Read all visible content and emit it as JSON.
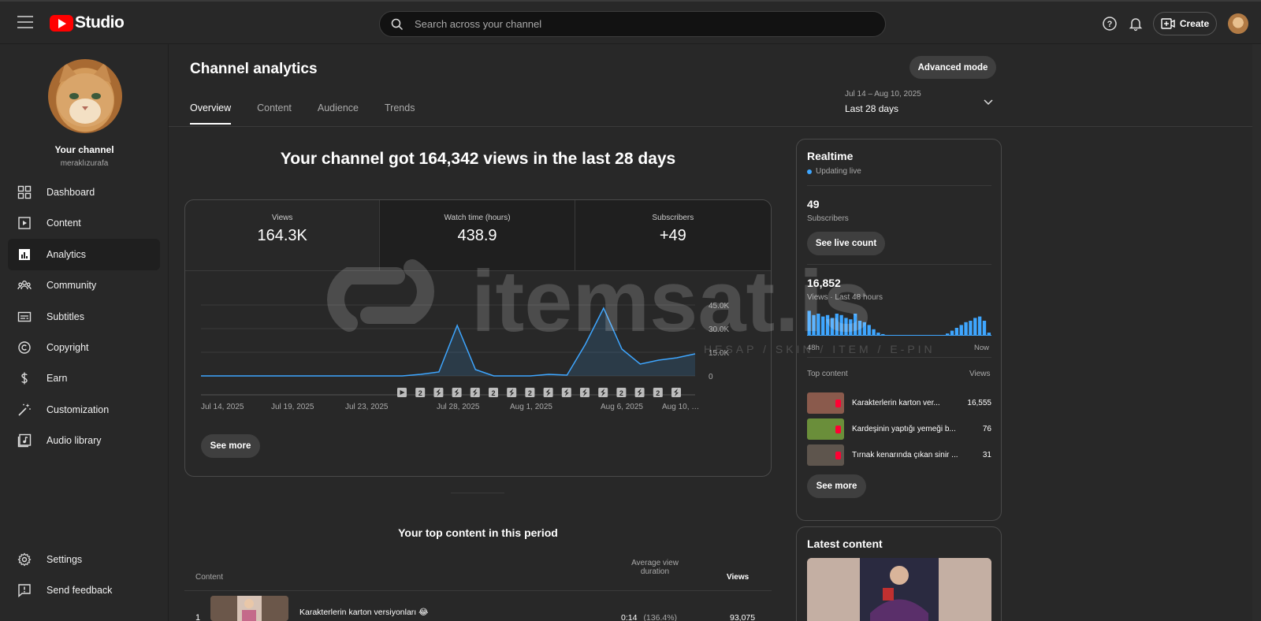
{
  "header": {
    "logo_text": "Studio",
    "search_placeholder": "Search across your channel",
    "create_label": "Create"
  },
  "sidebar": {
    "channel_title": "Your channel",
    "channel_handle": "meraklızurafa",
    "items": [
      {
        "label": "Dashboard",
        "icon": "dashboard-icon"
      },
      {
        "label": "Content",
        "icon": "content-icon"
      },
      {
        "label": "Analytics",
        "icon": "analytics-icon",
        "active": true
      },
      {
        "label": "Community",
        "icon": "community-icon"
      },
      {
        "label": "Subtitles",
        "icon": "subtitles-icon"
      },
      {
        "label": "Copyright",
        "icon": "copyright-icon"
      },
      {
        "label": "Earn",
        "icon": "dollar-icon"
      },
      {
        "label": "Customization",
        "icon": "magic-wand-icon"
      },
      {
        "label": "Audio library",
        "icon": "audio-library-icon"
      }
    ],
    "settings_label": "Settings",
    "feedback_label": "Send feedback"
  },
  "main": {
    "title": "Channel analytics",
    "advanced_mode_label": "Advanced mode",
    "tabs": [
      "Overview",
      "Content",
      "Audience",
      "Trends"
    ],
    "active_tab": "Overview",
    "date_range": {
      "dates": "Jul 14 – Aug 10, 2025",
      "label": "Last 28 days"
    },
    "headline": "Your channel got 164,342 views in the last 28 days",
    "metrics": [
      {
        "label": "Views",
        "value": "164.3K"
      },
      {
        "label": "Watch time (hours)",
        "value": "438.9"
      },
      {
        "label": "Subscribers",
        "value": "+49"
      }
    ],
    "see_more_label": "See more",
    "top_content": {
      "title": "Your top content in this period",
      "col_content": "Content",
      "col_avg_duration": "Average view duration",
      "col_views": "Views",
      "rows": [
        {
          "rank": "1",
          "title": "Karakterlerin karton versiyonları 😂",
          "avg_duration": "0:14",
          "pct": "(136.4%)",
          "views": "93,075"
        }
      ]
    }
  },
  "chart_data": {
    "type": "area",
    "x_tick_labels": [
      "Jul 14, 2025",
      "Jul 19, 2025",
      "Jul 23, 2025",
      "Jul 28, 2025",
      "Aug 1, 2025",
      "Aug 6, 2025",
      "Aug 10, …"
    ],
    "y_tick_labels": [
      "0",
      "15.0K",
      "30.0K",
      "45.0K"
    ],
    "ylim": [
      0,
      45000
    ],
    "series": [
      {
        "color": "#3ea6ff",
        "x": [
          "Jul 14",
          "Jul 15",
          "Jul 16",
          "Jul 17",
          "Jul 18",
          "Jul 19",
          "Jul 20",
          "Jul 21",
          "Jul 22",
          "Jul 23",
          "Jul 24",
          "Jul 25",
          "Jul 26",
          "Jul 27",
          "Jul 28",
          "Jul 29",
          "Jul 30",
          "Jul 31",
          "Aug 1",
          "Aug 2",
          "Aug 3",
          "Aug 4",
          "Aug 5",
          "Aug 6",
          "Aug 7",
          "Aug 8",
          "Aug 9",
          "Aug 10"
        ],
        "values": [
          0,
          0,
          0,
          0,
          0,
          0,
          0,
          0,
          0,
          0,
          0,
          0,
          1000,
          2500,
          32000,
          4000,
          0,
          0,
          0,
          1000,
          500,
          20000,
          43000,
          17000,
          7500,
          10000,
          11500,
          14000
        ]
      }
    ],
    "grid": true,
    "video_markers": [
      "play",
      "2",
      "short",
      "short",
      "short",
      "2",
      "short",
      "2",
      "short",
      "short",
      "short",
      "short",
      "2",
      "short",
      "2",
      "short"
    ]
  },
  "realtime": {
    "title": "Realtime",
    "live_label": "Updating live",
    "subscribers_value": "49",
    "subscribers_label": "Subscribers",
    "see_live_count_label": "See live count",
    "views_value": "16,852",
    "views_label": "Views · Last 48 hours",
    "axis_left": "48h",
    "axis_right": "Now",
    "bars": [
      0.85,
      0.7,
      0.75,
      0.65,
      0.7,
      0.6,
      0.75,
      0.7,
      0.6,
      0.55,
      0.75,
      0.5,
      0.45,
      0.35,
      0.2,
      0.08,
      0.03,
      0,
      0,
      0,
      0,
      0,
      0,
      0,
      0,
      0,
      0,
      0,
      0,
      0,
      0.05,
      0.15,
      0.25,
      0.35,
      0.45,
      0.5,
      0.6,
      0.65,
      0.5,
      0.08
    ],
    "top_content_label": "Top content",
    "views_col_label": "Views",
    "rows": [
      {
        "title": "Karakterlerin karton ver...",
        "views": "16,555",
        "thumb_color": "#8a5a4c"
      },
      {
        "title": "Kardeşinin yaptığı yemeği b...",
        "views": "76",
        "thumb_color": "#6a8e3a"
      },
      {
        "title": "Tırnak kenarında çıkan sinir ...",
        "views": "31",
        "thumb_color": "#5e554d"
      }
    ],
    "see_more_label": "See more"
  },
  "latest_content": {
    "title": "Latest content"
  },
  "watermark": {
    "text": "itemsat.is",
    "tagline": "HESAP / SKIN / ITEM / E-PIN .com"
  }
}
